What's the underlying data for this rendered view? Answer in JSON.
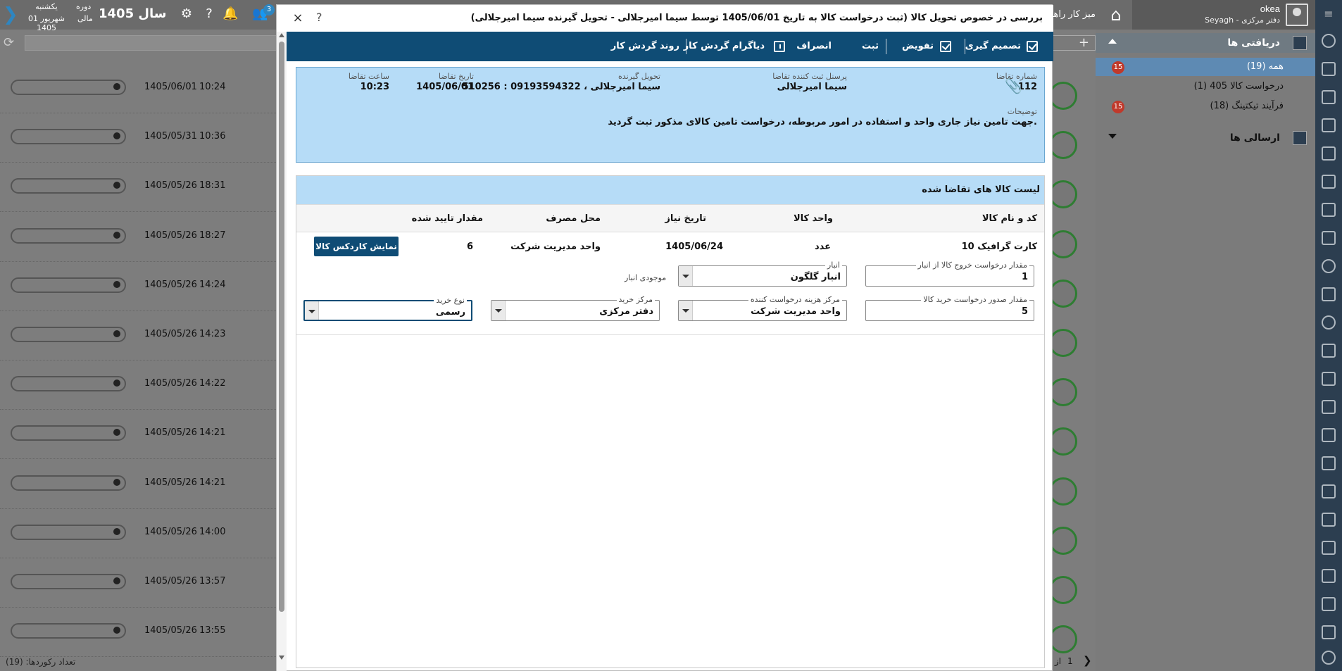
{
  "topbar": {
    "user_name": "okea",
    "user_org": "Seyagh - دفتر مرکزی",
    "dashboard_tab": "میز کار راهکار",
    "day": "یکشنبه",
    "date": "01 شهریور 1405",
    "period": "دوره",
    "period_sub": "مالی",
    "year": "سال 1405",
    "notification_count": "3"
  },
  "nav": {
    "received_title": "دریافتی ها",
    "items": [
      {
        "label": "همه (19)",
        "badge": "15"
      },
      {
        "label": "درخواست کالا 405 (1)",
        "badge": ""
      },
      {
        "label": "فرآیند تیکتینگ (18)",
        "badge": "15"
      }
    ],
    "sent_title": "ارسالی ها"
  },
  "background_list": {
    "rows": [
      {
        "date": "1405/06/01",
        "time": "10:24"
      },
      {
        "date": "1405/05/31",
        "time": "10:36"
      },
      {
        "date": "1405/05/26",
        "time": "18:31"
      },
      {
        "date": "1405/05/26",
        "time": "18:27"
      },
      {
        "date": "1405/05/26",
        "time": "14:24"
      },
      {
        "date": "1405/05/26",
        "time": "14:23"
      },
      {
        "date": "1405/05/26",
        "time": "14:22"
      },
      {
        "date": "1405/05/26",
        "time": "14:21"
      },
      {
        "date": "1405/05/26",
        "time": "14:21"
      },
      {
        "date": "1405/05/26",
        "time": "14:00"
      },
      {
        "date": "1405/05/26",
        "time": "13:57"
      },
      {
        "date": "1405/05/26",
        "time": "13:55"
      }
    ],
    "footer": "تعداد رکوردها: (19)",
    "pager_page": "1",
    "pager_of": "از"
  },
  "modal": {
    "title": "بررسی در خصوص تحویل کالا (ثبت درخواست کالا به تاریخ 1405/06/01 توسط سیما امیرجلالی - تحویل گیرنده سیما امیرجلالی)",
    "close": "×",
    "help": "?",
    "actions": {
      "decision": "تصمیم گیری",
      "delegate": "تفویض",
      "save": "ثبت",
      "cancel": "انصراف",
      "workflow_diagram": "دیاگرام گردش کار",
      "workflow_process": "روند گردش کار"
    },
    "info": {
      "request_no_label": "شماره تقاضا",
      "request_no": "112",
      "registrar_label": "پرسنل ثبت کننده تقاضا",
      "registrar": "سیما امیرجلالی",
      "receiver_label": "تحویل گیرنده",
      "receiver": "510256 : سیما امیرجلالی ، 09193594322",
      "request_date_label": "تاریخ تقاضا",
      "request_date": "1405/06/01",
      "request_time_label": "ساعت تقاضا",
      "request_time": "10:23",
      "desc_label": "توضیحات",
      "desc": "جهت تامین نیاز جاری واحد و استفاده در امور مربوطه، درخواست تامین کالای مذکور ثبت گردید."
    },
    "items": {
      "title": "لیست کالا های تقاضا شده",
      "columns": [
        "کد و نام کالا",
        "واحد کالا",
        "تاریخ نیاز",
        "محل مصرف",
        "مقدار تایید شده"
      ],
      "row": {
        "item": "10 کارت گرافیک",
        "unit": "عدد",
        "need_date": "1405/06/24",
        "usage_place": "واحد مدیریت شرکت",
        "approved_qty": "6"
      },
      "kardex_button": "نمایش کاردکس کالا",
      "stock_label": "موجودی انبار",
      "fields": {
        "out_qty_label": "مقدار درخواست خروج کالا از انبار",
        "out_qty": "1",
        "warehouse_label": "انبار",
        "warehouse": "انبار گلگون",
        "purchase_qty_label": "مقدار صدور درخواست خرید کالا",
        "purchase_qty": "5",
        "cost_center_label": "مرکز هزینه درخواست کننده",
        "cost_center": "واحد مدیریت شرکت",
        "purchase_center_label": "مرکز خرید",
        "purchase_center": "دفتر مرکزی",
        "purchase_type_label": "نوع خرید",
        "purchase_type": "رسمی"
      }
    }
  }
}
